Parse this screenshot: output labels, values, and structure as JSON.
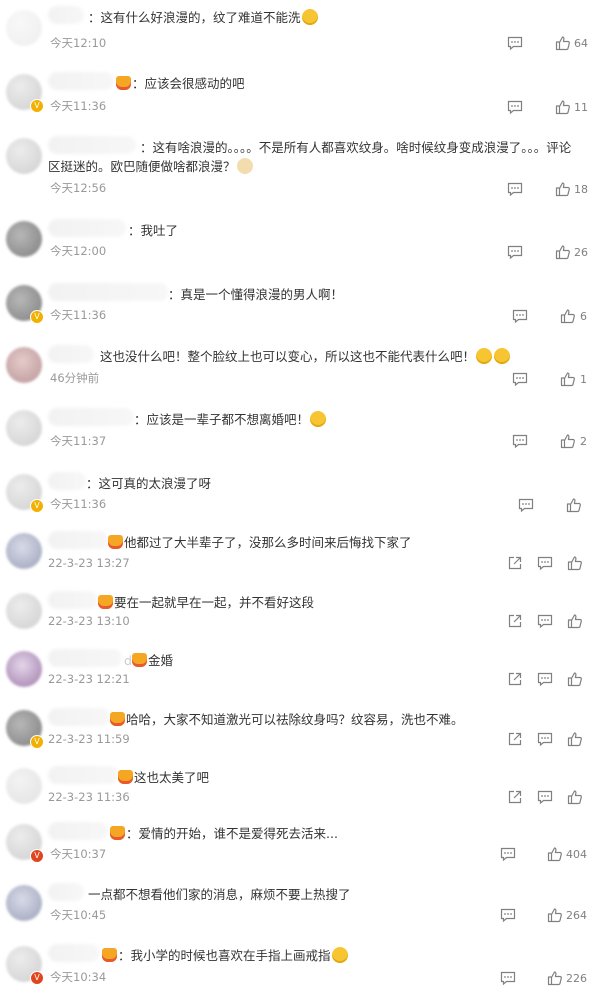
{
  "comments": [
    {
      "text": "：这有什么好浪漫的，纹了难道不能洗",
      "emoji_end": "sweat-smile-emoji",
      "time": "今天12:10",
      "likes": "64"
    },
    {
      "text": "：应该会很感动的吧",
      "time": "今天11:36",
      "likes": "11"
    },
    {
      "text": "：这有啥浪漫的。。。。不是所有人都喜欢纹身。啥时候纹身变成浪漫了。。。评论区挺迷的。欧巴随便做啥都浪漫？",
      "emoji_end": "dog-emoji",
      "time": "今天12:56",
      "likes": "18"
    },
    {
      "text": "：我吐了",
      "time": "今天12:00",
      "likes": "26"
    },
    {
      "text": "：真是一个懂得浪漫的男人啊！",
      "time": "今天11:36",
      "likes": "6"
    },
    {
      "text": "这也没什么吧！整个脸纹上也可以变心，所以这也不能代表什么吧！",
      "emoji_end": "thinking-emoji-x2",
      "time": "46分钟前",
      "likes": "1"
    },
    {
      "text": "：应该是一辈子都不想离婚吧！",
      "emoji_end": "scream-emoji",
      "time": "今天11:37",
      "likes": "2"
    },
    {
      "text": "：这可真的太浪漫了呀",
      "time": "今天11:36",
      "likes": ""
    },
    {
      "text": "他都过了大半辈子了，没那么多时间来后悔找下家了",
      "time": "22-3-23 13:27",
      "likes": ""
    },
    {
      "text": "要在一起就早在一起，并不看好这段",
      "time": "22-3-23 13:10",
      "likes": ""
    },
    {
      "text": "d",
      "text2": "金婚",
      "time": "22-3-23 12:21",
      "likes": ""
    },
    {
      "text": "哈哈，大家不知道激光可以祛除纹身吗？纹容易，洗也不难。",
      "time": "22-3-23 11:59",
      "likes": ""
    },
    {
      "text": "这也太美了吧",
      "time": "22-3-23 11:36",
      "likes": ""
    },
    {
      "text": "：爱情的开始，谁不是爱得死去活来...",
      "time": "今天10:37",
      "likes": "404"
    },
    {
      "text": "一点都不想看他们家的消息，麻烦不要上热搜了",
      "time": "今天10:45",
      "likes": "264"
    },
    {
      "text": "：我小学的时候也喜欢在手指上画戒指",
      "emoji_end": "laugh-cry-emoji",
      "time": "今天10:34",
      "likes": "226"
    }
  ],
  "icons": {
    "reply": "comment-bubble-icon",
    "like": "thumbs-up-icon",
    "share": "share-arrow-icon",
    "fan_badge": "crown-fan-badge-icon",
    "verified": "verified-v-badge-icon"
  },
  "colors": {
    "text": "#333333",
    "meta": "#999999",
    "icon": "#808080",
    "verified_yellow": "#f2b000",
    "verified_red": "#e0461e"
  }
}
